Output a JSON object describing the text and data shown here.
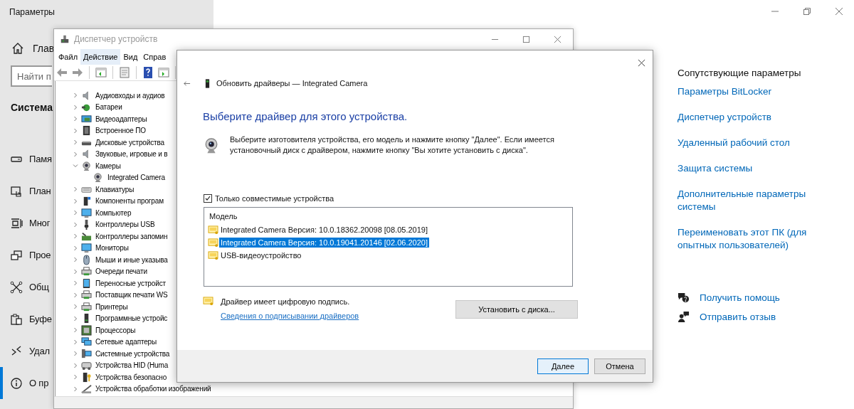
{
  "settings": {
    "title": "Параметры",
    "home": {
      "label": "Глав"
    },
    "search": {
      "placeholder": "Найти п"
    },
    "section": "Система",
    "nav": [
      {
        "label": "Памя",
        "selected": false
      },
      {
        "label": "План",
        "selected": false
      },
      {
        "label": "Мног",
        "selected": false
      },
      {
        "label": "Прое",
        "selected": false
      },
      {
        "label": "Общ",
        "selected": false
      },
      {
        "label": "Буфе",
        "selected": false
      },
      {
        "label": "Удал",
        "selected": false
      },
      {
        "label": "О пр",
        "selected": true
      }
    ],
    "related": {
      "heading": "Сопутствующие параметры",
      "links": [
        "Параметры BitLocker",
        "Диспетчер устройств",
        "Удаленный рабочий стол",
        "Защита системы",
        "Дополнительные параметры системы",
        "Переименовать этот ПК (для опытных пользователей)"
      ]
    },
    "support": [
      "Получить помощь",
      "Отправить отзыв"
    ]
  },
  "device_manager": {
    "title": "Диспетчер устройств",
    "menu": [
      {
        "label": "Файл",
        "selected": false
      },
      {
        "label": "Действие",
        "selected": true
      },
      {
        "label": "Вид",
        "selected": false
      },
      {
        "label": "Справ",
        "selected": false
      }
    ],
    "tree": [
      {
        "label": "Аудиовходы и аудиов",
        "expanded": false
      },
      {
        "label": "Батареи",
        "expanded": false
      },
      {
        "label": "Видеоадаптеры",
        "expanded": false
      },
      {
        "label": "Встроенное ПО",
        "expanded": false
      },
      {
        "label": "Дисковые устройства",
        "expanded": false
      },
      {
        "label": "Звуковые, игровые и в",
        "expanded": false
      },
      {
        "label": "Камеры",
        "expanded": true,
        "children": [
          {
            "label": "Integrated Camera"
          }
        ]
      },
      {
        "label": "Клавиатуры",
        "expanded": false
      },
      {
        "label": "Компоненты програм",
        "expanded": false
      },
      {
        "label": "Компьютер",
        "expanded": false
      },
      {
        "label": "Контроллеры USB",
        "expanded": false
      },
      {
        "label": "Контроллеры запомин",
        "expanded": false
      },
      {
        "label": "Мониторы",
        "expanded": false
      },
      {
        "label": "Мыши и иные указыва",
        "expanded": false
      },
      {
        "label": "Очереди печати",
        "expanded": false
      },
      {
        "label": "Переносные устройст",
        "expanded": false
      },
      {
        "label": "Поставщик печати WS",
        "expanded": false
      },
      {
        "label": "Принтеры",
        "expanded": false
      },
      {
        "label": "Программные устройс",
        "expanded": false
      },
      {
        "label": "Процессоры",
        "expanded": false
      },
      {
        "label": "Сетевые адаптеры",
        "expanded": false
      },
      {
        "label": "Системные устройства",
        "expanded": false
      },
      {
        "label": "Устройства HID (Huma",
        "expanded": false
      },
      {
        "label": "Устройства безопасно",
        "expanded": false
      },
      {
        "label": "Устройства обработки изображений",
        "expanded": false
      }
    ]
  },
  "dialog": {
    "title": "Обновить драйверы — Integrated Camera",
    "heading": "Выберите драйвер для этого устройства.",
    "description": "Выберите изготовителя устройства, его модель и нажмите кнопку \"Далее\". Если имеется установочный диск с драйвером, нажмите кнопку \"Вы хотите установить с диска\".",
    "compatible_only": {
      "label": "Только совместимые устройства",
      "checked": true
    },
    "models": {
      "header": "Модель",
      "items": [
        {
          "label": "Integrated Camera Версия: 10.0.18362.20098 [08.05.2019]",
          "selected": false
        },
        {
          "label": "Integrated Camera Версия: 10.0.19041.20146 [02.06.2020]",
          "selected": true
        },
        {
          "label": "USB-видеоустройство",
          "selected": false
        }
      ]
    },
    "signature": "Драйвер имеет цифровую подпись.",
    "signature_link": "Сведения о подписывании драйверов",
    "have_disk_button": "Установить с диска...",
    "buttons": [
      {
        "label": "Далее",
        "default": true
      },
      {
        "label": "Отмена",
        "default": false
      }
    ]
  }
}
